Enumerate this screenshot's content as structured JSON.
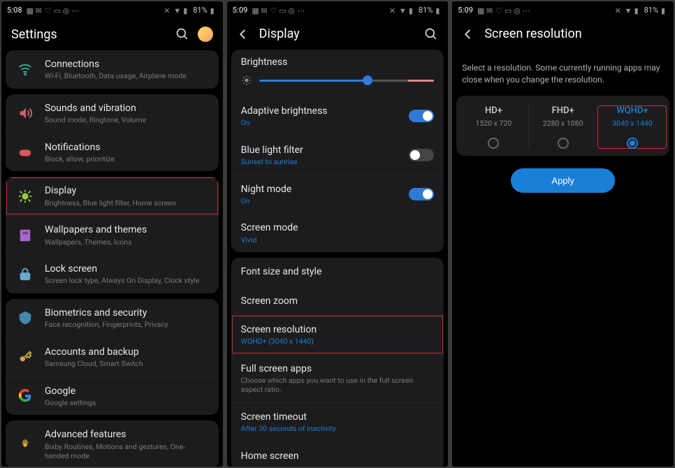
{
  "status": {
    "time1": "5:08",
    "time2": "5:09",
    "time3": "5:09",
    "battery": "81%"
  },
  "screen1": {
    "title": "Settings",
    "items": [
      {
        "icon": "wifi",
        "title": "Connections",
        "sub": "Wi-Fi, Bluetooth, Data usage, Airplane mode"
      },
      {
        "icon": "sound",
        "title": "Sounds and vibration",
        "sub": "Sound mode, Ringtone, Volume"
      },
      {
        "icon": "notif",
        "title": "Notifications",
        "sub": "Block, allow, prioritize"
      },
      {
        "icon": "display",
        "title": "Display",
        "sub": "Brightness, Blue light filter, Home screen",
        "hl": true
      },
      {
        "icon": "wall",
        "title": "Wallpapers and themes",
        "sub": "Wallpapers, Themes, Icons"
      },
      {
        "icon": "lock",
        "title": "Lock screen",
        "sub": "Screen lock type, Always On Display, Clock style"
      },
      {
        "icon": "bio",
        "title": "Biometrics and security",
        "sub": "Face recognition, Fingerprints, Privacy"
      },
      {
        "icon": "key",
        "title": "Accounts and backup",
        "sub": "Samsung Cloud, Smart Switch"
      },
      {
        "icon": "google",
        "title": "Google",
        "sub": "Google settings"
      },
      {
        "icon": "adv",
        "title": "Advanced features",
        "sub": "Bixby Routines, Motions and gestures, One-handed mode"
      }
    ]
  },
  "screen2": {
    "title": "Display",
    "brightness_label": "Brightness",
    "items1": [
      {
        "title": "Adaptive brightness",
        "sub": "On",
        "accent": true,
        "toggle": true,
        "on": true
      },
      {
        "title": "Blue light filter",
        "sub": "Sunset to sunrise",
        "accent": true,
        "toggle": true,
        "on": false
      },
      {
        "title": "Night mode",
        "sub": "On",
        "accent": true,
        "toggle": true,
        "on": true
      },
      {
        "title": "Screen mode",
        "sub": "Vivid",
        "accent": true
      }
    ],
    "items2": [
      {
        "title": "Font size and style"
      },
      {
        "title": "Screen zoom"
      },
      {
        "title": "Screen resolution",
        "sub": "WQHD+ (3040 x 1440)",
        "accent": true,
        "hl": true
      },
      {
        "title": "Full screen apps",
        "sub": "Choose which apps you want to use in the full screen aspect ratio."
      },
      {
        "title": "Screen timeout",
        "sub": "After 30 seconds of inactivity",
        "accent": true
      },
      {
        "title": "Home screen"
      }
    ]
  },
  "screen3": {
    "title": "Screen resolution",
    "instruction": "Select a resolution. Some currently running apps may close when you change the resolution.",
    "options": [
      {
        "name": "HD+",
        "dim": "1520 x 720",
        "selected": false
      },
      {
        "name": "FHD+",
        "dim": "2280 x 1080",
        "selected": false
      },
      {
        "name": "WQHD+",
        "dim": "3040 x 1440",
        "selected": true,
        "hl": true
      }
    ],
    "apply": "Apply"
  }
}
